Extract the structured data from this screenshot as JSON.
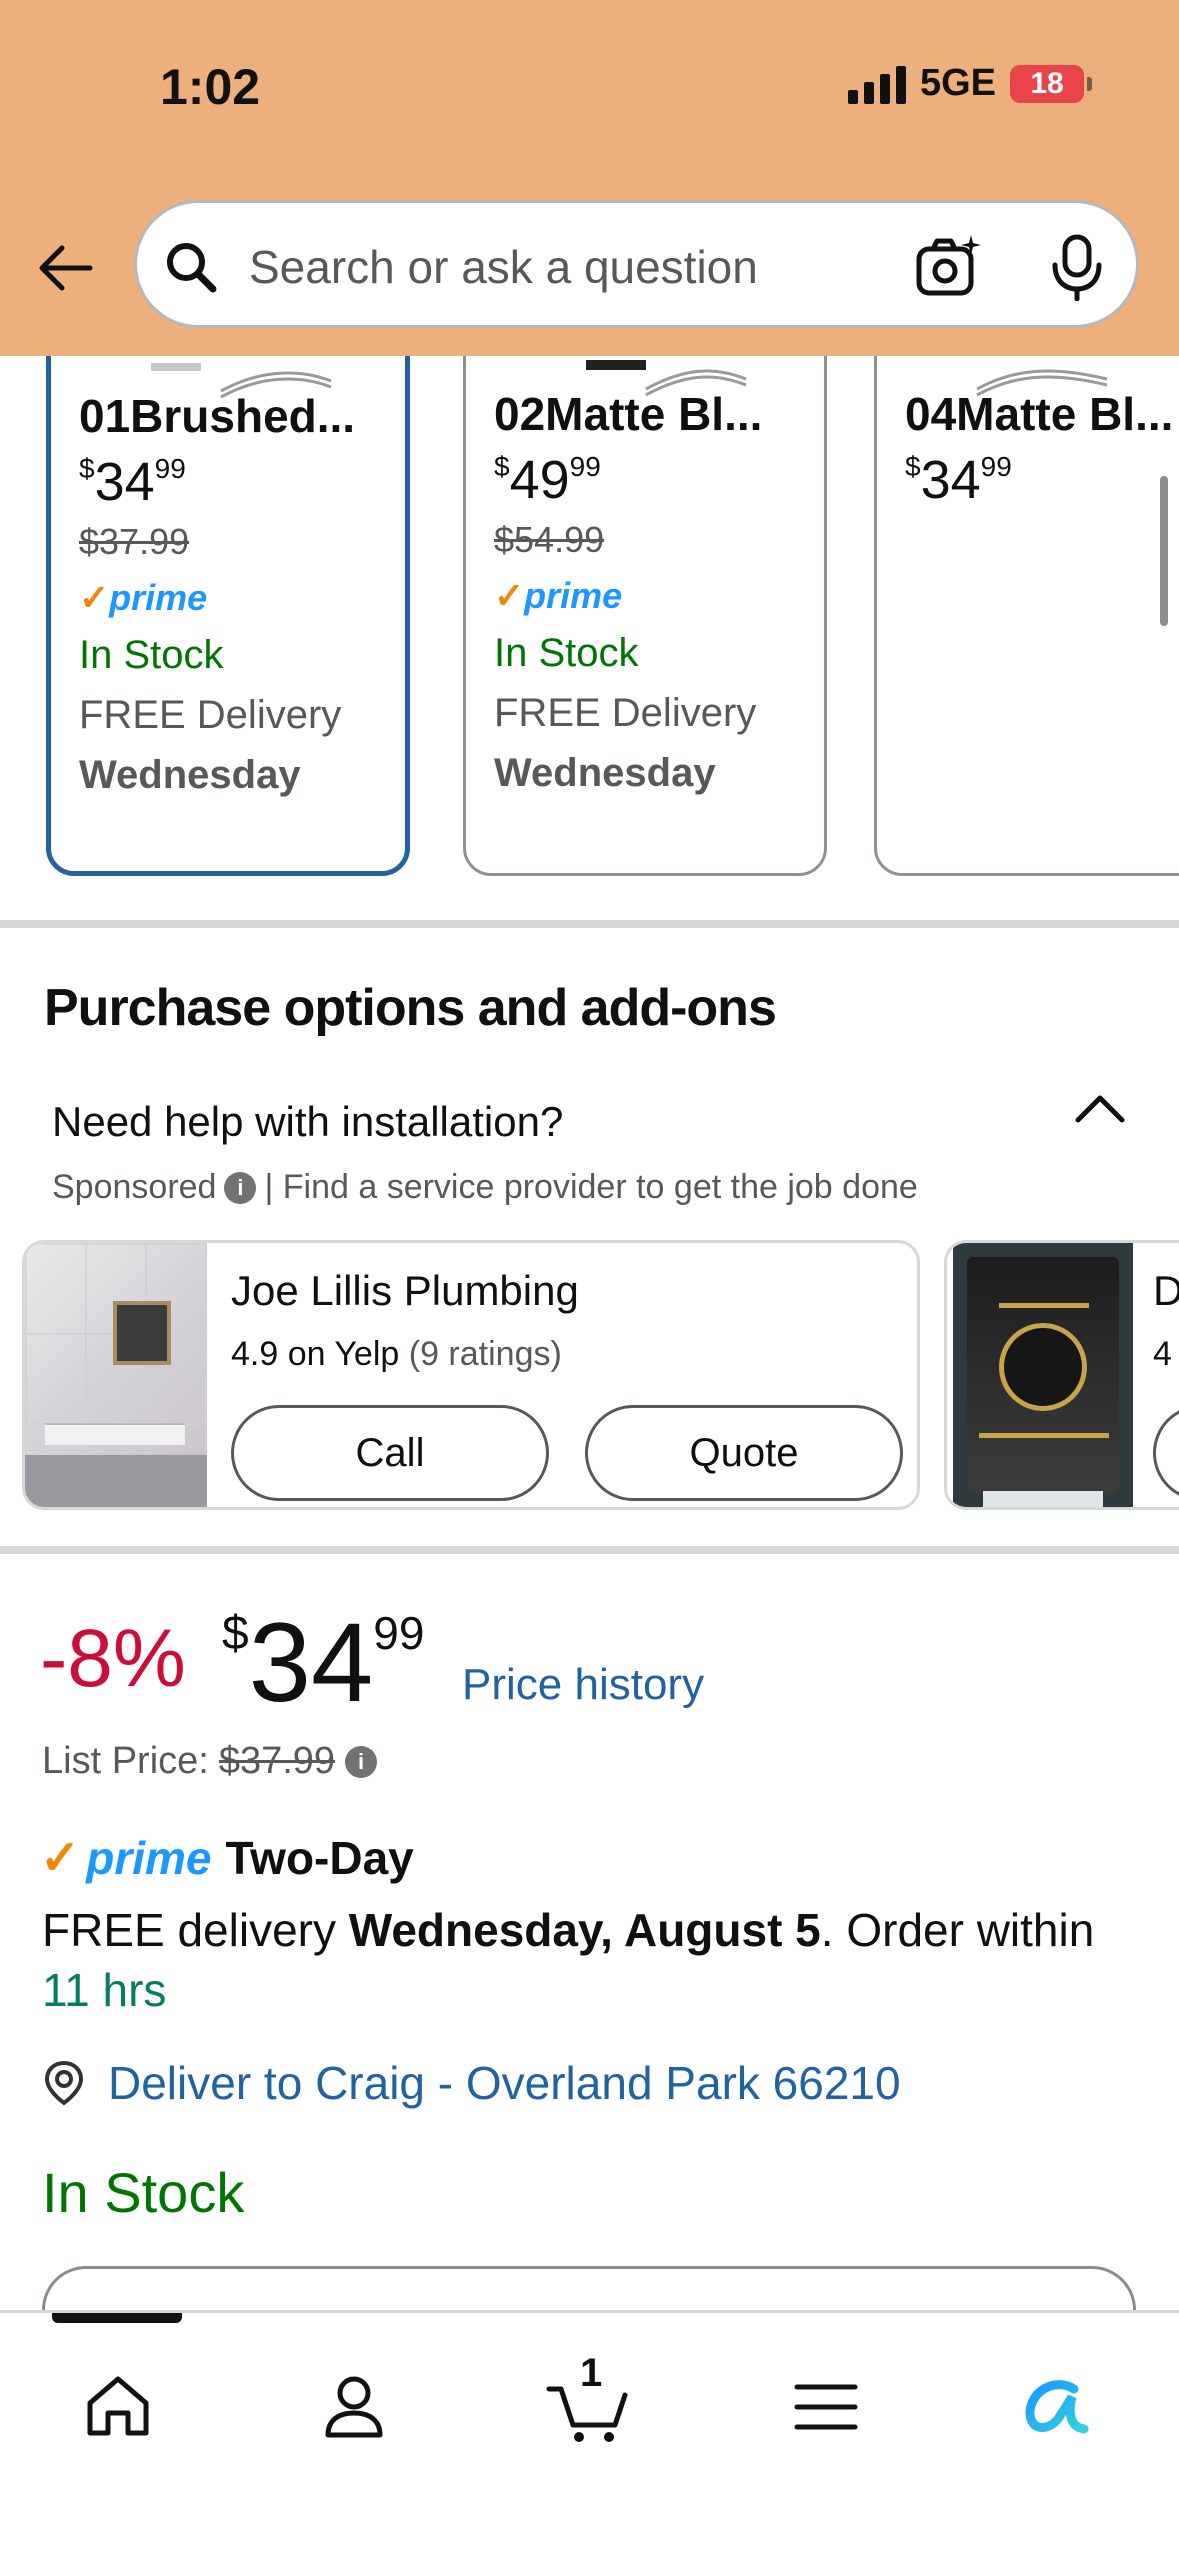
{
  "status_bar": {
    "time": "1:02",
    "network": "5GE",
    "battery": "18"
  },
  "search": {
    "placeholder": "Search or ask a question"
  },
  "variants": [
    {
      "title": "01Brushed...",
      "price_whole": "34",
      "price_frac": "99",
      "currency": "$",
      "list_price": "$37.99",
      "prime": "prime",
      "stock": "In Stock",
      "delivery": "FREE Delivery",
      "day": "Wednesday",
      "selected": true
    },
    {
      "title": "02Matte Bl...",
      "price_whole": "49",
      "price_frac": "99",
      "currency": "$",
      "list_price": "$54.99",
      "prime": "prime",
      "stock": "In Stock",
      "delivery": "FREE Delivery",
      "day": "Wednesday",
      "selected": false
    },
    {
      "title": "04Matte Bl...",
      "price_whole": "34",
      "price_frac": "99",
      "currency": "$",
      "selected": false
    }
  ],
  "purchase_options": {
    "title": "Purchase options and add-ons",
    "help_question": "Need help with installation?",
    "sponsored": "Sponsored",
    "sponsored_text": "| Find a service provider to get the job done",
    "providers": [
      {
        "name": "Joe Lillis Plumbing",
        "rating": "4.9 on Yelp",
        "rating_count": "(9 ratings)",
        "call_label": "Call",
        "quote_label": "Quote"
      },
      {
        "name": "D",
        "rating": "4"
      }
    ]
  },
  "price_block": {
    "discount": "-8%",
    "currency": "$",
    "price_whole": "34",
    "price_frac": "99",
    "price_history": "Price history",
    "list_price_label": "List Price:",
    "list_price": "$37.99",
    "prime_check": "✓",
    "prime": "prime",
    "two_day": "Two-Day",
    "free_delivery": "FREE delivery",
    "delivery_date": "Wednesday, August 5",
    "order_within": ". Order within",
    "time_left": "11 hrs",
    "deliver_to": "Deliver to Craig - Overland Park 66210",
    "stock": "In Stock"
  },
  "bottom_nav": {
    "cart_count": "1"
  },
  "colors": {
    "header": "#edb07c",
    "link": "#2162a1",
    "prime": "#1a98ff",
    "stock": "#007600",
    "discount": "#cc0c39"
  }
}
